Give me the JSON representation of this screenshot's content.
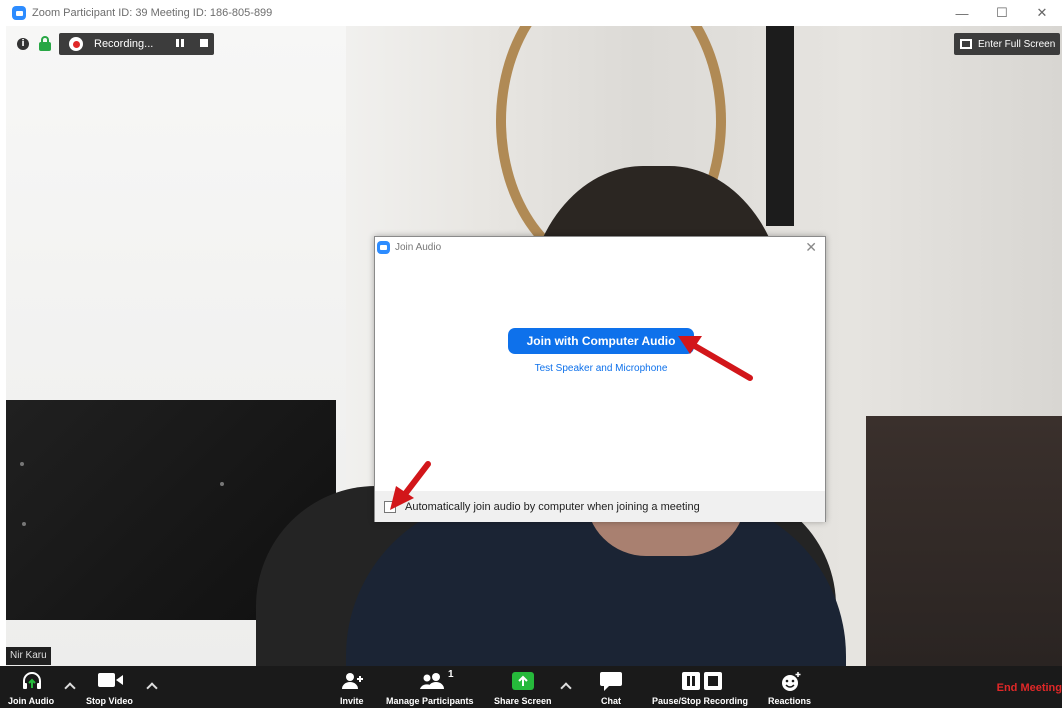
{
  "window": {
    "title": "Zoom Participant ID: 39   Meeting ID: 186-805-899",
    "controls": {
      "minimize": "—",
      "maximize": "☐",
      "close": "✕"
    }
  },
  "recording": {
    "label": "Recording..."
  },
  "fullscreen": {
    "label": "Enter Full Screen"
  },
  "participant_name": "Nir Karu",
  "dialog": {
    "title": "Join Audio",
    "join_button": "Join with Computer Audio",
    "test_link": "Test Speaker and Microphone",
    "checkbox_label": "Automatically join audio by computer when joining a meeting",
    "checkbox_checked": false
  },
  "toolbar": {
    "join_audio": "Join Audio",
    "stop_video": "Stop Video",
    "invite": "Invite",
    "manage_participants": "Manage Participants",
    "participant_count": "1",
    "share_screen": "Share Screen",
    "chat": "Chat",
    "pause_stop_recording": "Pause/Stop Recording",
    "reactions": "Reactions",
    "end_meeting": "End Meeting"
  },
  "colors": {
    "accent": "#0e71eb",
    "end_meeting": "#e02828",
    "share_screen": "#26b93b",
    "secure": "#28a745",
    "annotation_arrow": "#d2161a"
  }
}
